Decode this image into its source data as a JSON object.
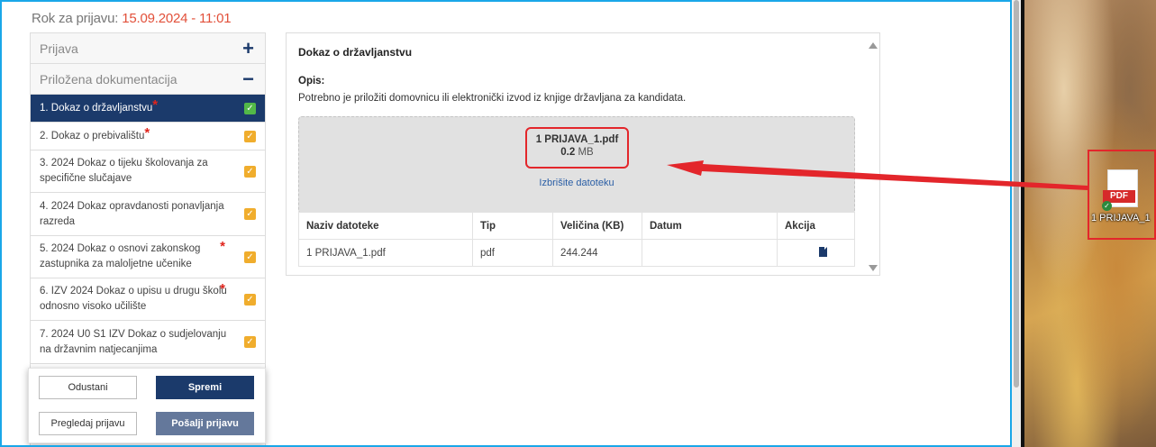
{
  "deadline": {
    "label": "Rok za prijavu:",
    "value": "15.09.2024 - 11:01"
  },
  "sidebar": {
    "sections": [
      {
        "label": "Prijava",
        "toggle": "+"
      },
      {
        "label": "Priložena dokumentacija",
        "toggle": "−"
      }
    ],
    "items": [
      {
        "label": "1. Dokaz o državljanstvu",
        "required": true,
        "status": "complete-green"
      },
      {
        "label": "2. Dokaz o prebivalištu",
        "required": true,
        "status": "complete"
      },
      {
        "label": "3. 2024 Dokaz o tijeku školovanja za specifične slučajave",
        "required": false,
        "status": "complete"
      },
      {
        "label": "4. 2024 Dokaz opravdanosti ponavljanja razreda",
        "required": false,
        "status": "complete"
      },
      {
        "label": "5. 2024 Dokaz o osnovi zakonskog zastupnika za maloljetne učenike",
        "required": true,
        "status": "complete"
      },
      {
        "label": "6. IZV 2024 Dokaz o upisu u drugu školu odnosno visoko učilište",
        "required": true,
        "status": "complete"
      },
      {
        "label": "7. 2024 U0 S1 IZV Dokaz o sudjelovanju na državnim natjecanjima",
        "required": false,
        "status": "complete"
      }
    ],
    "required_marker": "*",
    "check_glyph": "✓"
  },
  "actions": {
    "cancel": "Odustani",
    "save": "Spremi",
    "preview": "Pregledaj prijavu",
    "submit": "Pošalji prijavu"
  },
  "main": {
    "title": "Dokaz o državljanstvu",
    "opis_label": "Opis:",
    "opis_text": "Potrebno je priložiti domovnicu ili elektronički izvod iz knjige državljana za kandidata.",
    "upload": {
      "file_name": "1 PRIJAVA_1.pdf",
      "size_value": "0.2",
      "size_unit": "MB",
      "remove_link": "Izbrišite datoteku"
    },
    "table": {
      "headers": [
        "Naziv datoteke",
        "Tip",
        "Veličina (KB)",
        "Datum",
        "Akcija"
      ],
      "rows": [
        {
          "name": "1 PRIJAVA_1.pdf",
          "type": "pdf",
          "size": "244.244",
          "date": ""
        }
      ]
    }
  },
  "desktop": {
    "icon_label": "1 PRIJAVA_1",
    "icon_badge": "PDF",
    "icon_name": "pdf-file-icon"
  },
  "colors": {
    "accent": "#1b3a6b",
    "highlight": "#e3262b",
    "check_orange": "#f0ad2d",
    "check_green": "#53b848",
    "deadline": "#e2503a"
  }
}
